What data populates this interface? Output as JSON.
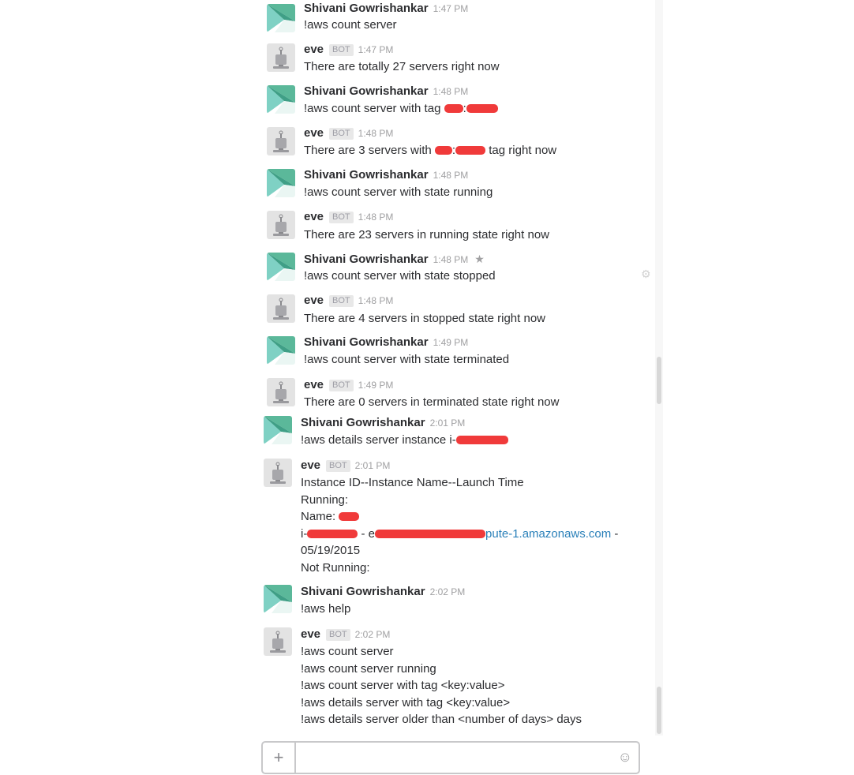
{
  "colors": {
    "link": "#2a80b9",
    "redaction": "#f03a3a",
    "badge_bg": "#e8e8e8",
    "user_avatar": [
      "#5bb89a",
      "#7fd1c4",
      "#3f9f86"
    ],
    "bot_avatar_bg": "#e3e3e3"
  },
  "icons": {
    "user_avatar": "geometric-avatar",
    "bot_avatar": "robot-avatar",
    "star": "star-icon",
    "gear": "gear-icon",
    "plus": "plus-icon",
    "emoji": "emoji-icon"
  },
  "messages": [
    {
      "sender": "Shivani Gowrishankar",
      "time": "1:47 PM",
      "text": "!aws count server"
    },
    {
      "sender": "eve",
      "bot_label": "BOT",
      "time": "1:47 PM",
      "text": "There are totally 27 servers right now"
    },
    {
      "sender": "Shivani Gowrishankar",
      "time": "1:48 PM",
      "text": "!aws count server with tag",
      "text_after_redaction": ":"
    },
    {
      "sender": "eve",
      "bot_label": "BOT",
      "time": "1:48 PM",
      "text": "There are 3 servers with",
      "text_mid": ":",
      "text_end": "tag right now"
    },
    {
      "sender": "Shivani Gowrishankar",
      "time": "1:48 PM",
      "text": "!aws count server with state running"
    },
    {
      "sender": "eve",
      "bot_label": "BOT",
      "time": "1:48 PM",
      "text": "There are 23 servers in running state right now"
    },
    {
      "sender": "Shivani Gowrishankar",
      "time": "1:48 PM",
      "starred": true,
      "text": "!aws count server with state stopped"
    },
    {
      "sender": "eve",
      "bot_label": "BOT",
      "time": "1:48 PM",
      "text": "There are 4 servers in stopped state right now"
    },
    {
      "sender": "Shivani Gowrishankar",
      "time": "1:49 PM",
      "text": "!aws count server with state terminated"
    },
    {
      "sender": "eve",
      "bot_label": "BOT",
      "time": "1:49 PM",
      "text": "There are 0 servers in terminated state right now"
    },
    {
      "sender": "Shivani Gowrishankar",
      "time": "2:01 PM",
      "text": "!aws details server instance i-"
    },
    {
      "sender": "eve",
      "bot_label": "BOT",
      "time": "2:01 PM",
      "lines": [
        "Instance ID--Instance Name--Launch Time",
        "Running:",
        "Name:",
        "i-",
        "05/19/2015",
        "Not Running:"
      ],
      "line4_sep": "- e",
      "link_text": "pute-1.amazonaws.com",
      "link_suffix": " -"
    },
    {
      "sender": "Shivani Gowrishankar",
      "time": "2:02 PM",
      "text": "!aws help"
    },
    {
      "sender": "eve",
      "bot_label": "BOT",
      "time": "2:02 PM",
      "lines": [
        "!aws count server",
        "!aws count server running",
        "!aws count server with tag <key:value>",
        "!aws details server with tag <key:value>",
        "!aws details server older than <number of days> days"
      ]
    }
  ],
  "composer": {
    "value": "",
    "placeholder": ""
  }
}
